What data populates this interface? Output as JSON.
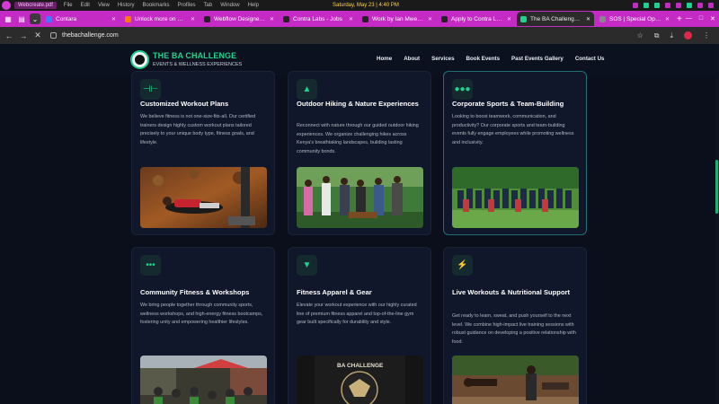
{
  "os": {
    "title": "Webcreate.pdf",
    "menu": [
      "File",
      "Edit",
      "View",
      "History",
      "Bookmarks",
      "Profiles",
      "Tab",
      "Window",
      "Help"
    ],
    "clock": "Saturday, May 23 | 4:40 PM"
  },
  "tabs": [
    {
      "title": "Contara",
      "fav": "#3a7bff"
    },
    {
      "title": "Unlock more on Contra",
      "fav": "#ff7a00"
    },
    {
      "title": "Webflow Designer on Contra",
      "fav": "#222222"
    },
    {
      "title": "Contra Labs - Jobs",
      "fav": "#222222"
    },
    {
      "title": "Work by Ian Mwendwa",
      "fav": "#222222"
    },
    {
      "title": "Apply to Contra Labs",
      "fav": "#222222"
    },
    {
      "title": "The BA Challenge | Fitness",
      "fav": "#1ed38e",
      "active": true
    },
    {
      "title": "SOS | Special Operations",
      "fav": "#888888"
    }
  ],
  "browser": {
    "url": "thebachallenge.com"
  },
  "site": {
    "brand": "THE BA CHALLENGE",
    "tagline": "EVENTS & WELLNESS EXPERIENCES",
    "nav": [
      "Home",
      "About",
      "Services",
      "Book Events",
      "Past Events Gallery",
      "Contact Us"
    ]
  },
  "cards": [
    {
      "icon": "dumbbell-icon",
      "glyph": "⊣⊢",
      "title": "Customized Workout Plans",
      "text": "We believe fitness is not one-size-fits-all. Our certified trainers design highly custom workout plans tailored precisely to your unique body type, fitness goals, and lifestyle."
    },
    {
      "icon": "mountain-icon",
      "glyph": "▲",
      "title": "Outdoor Hiking & Nature Experiences",
      "text": "Reconnect with nature through our guided outdoor hiking experiences. We organize challenging hikes across Kenya's breathtaking landscapes, building lasting community bonds."
    },
    {
      "icon": "group-icon",
      "glyph": "●●●",
      "title": "Corporate Sports & Team-Building",
      "text": "Looking to boost teamwork, communication, and productivity? Our corporate sports and team-building events fully engage employees while promoting wellness and inclusivity."
    },
    {
      "icon": "people-icon",
      "glyph": "•••",
      "title": "Community Fitness & Workshops",
      "text": "We bring people together through community sports, wellness workshops, and high-energy fitness bootcamps, fostering unity and empowering healthier lifestyles."
    },
    {
      "icon": "shirt-icon",
      "glyph": "▼",
      "title": "Fitness Apparel & Gear",
      "text": "Elevate your workout experience with our highly curated line of premium fitness apparel and top-of-the-line gym gear built specifically for durability and style."
    },
    {
      "icon": "bolt-icon",
      "glyph": "⚡",
      "title": "Live Workouts & Nutritional Support",
      "text": "Get ready to learn, sweat, and push yourself to the next level. We combine high-impact live training sessions with robust guidance on developing a positive relationship with food."
    }
  ],
  "apparel_print": "BA CHALLENGE"
}
